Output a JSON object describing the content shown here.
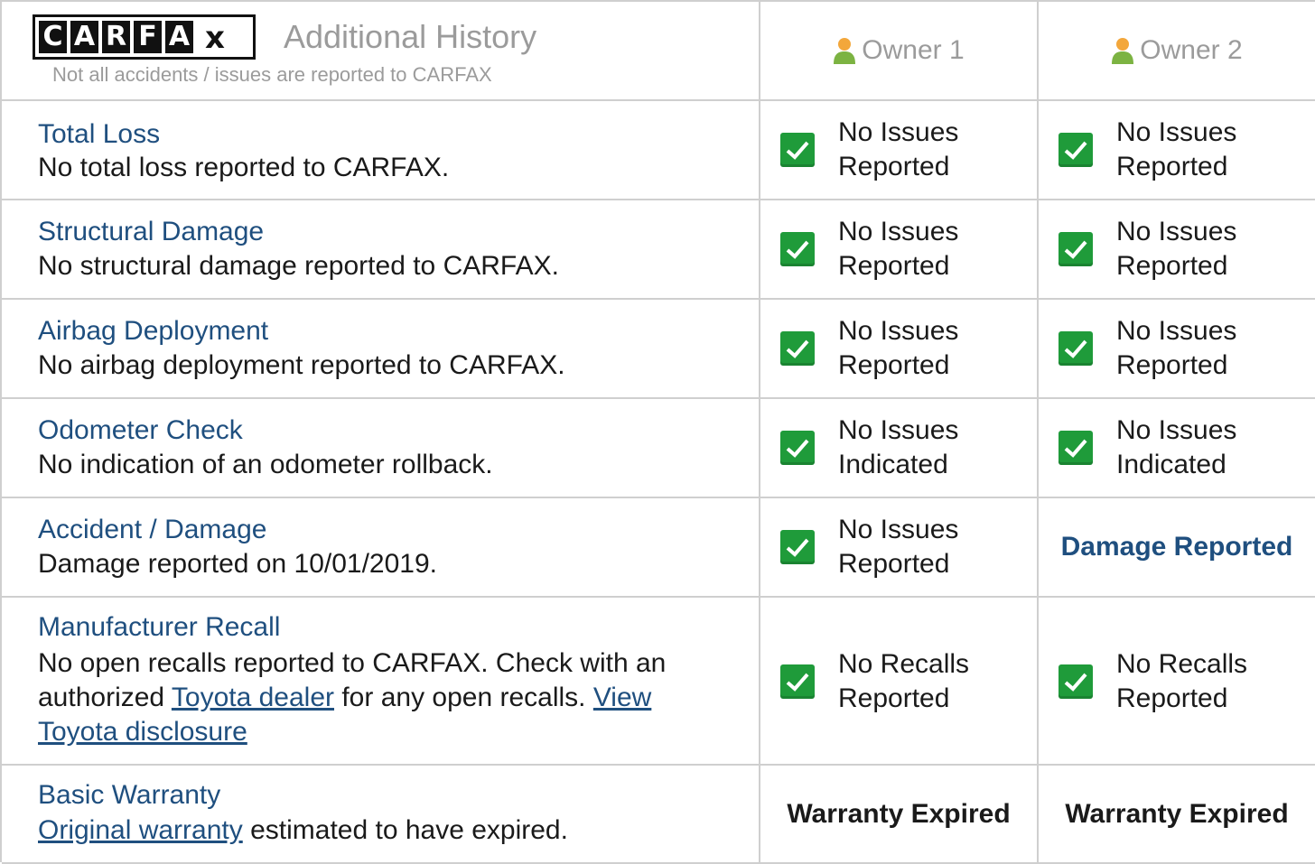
{
  "header": {
    "logo_letters": [
      "C",
      "A",
      "R",
      "F",
      "A"
    ],
    "logo_x": "x",
    "title": "Additional History",
    "subtitle": "Not all accidents / issues are reported to CARFAX",
    "owners": [
      "Owner 1",
      "Owner 2"
    ],
    "owner_icon": "person-icon"
  },
  "rows": {
    "total_loss": {
      "title": "Total Loss",
      "desc": "No total loss reported to CARFAX.",
      "owner1": [
        "No Issues",
        "Reported"
      ],
      "owner2": [
        "No Issues",
        "Reported"
      ]
    },
    "structural": {
      "title": "Structural Damage",
      "desc": "No structural damage reported to CARFAX.",
      "owner1": [
        "No Issues",
        "Reported"
      ],
      "owner2": [
        "No Issues",
        "Reported"
      ]
    },
    "airbag": {
      "title": "Airbag Deployment",
      "desc": "No airbag deployment reported to CARFAX.",
      "owner1": [
        "No Issues",
        "Reported"
      ],
      "owner2": [
        "No Issues",
        "Reported"
      ]
    },
    "odometer": {
      "title": "Odometer Check",
      "desc": "No indication of an odometer rollback.",
      "owner1": [
        "No Issues",
        "Indicated"
      ],
      "owner2": [
        "No Issues",
        "Indicated"
      ]
    },
    "accident": {
      "title": "Accident / Damage",
      "desc": "Damage reported on 10/01/2019.",
      "owner1": [
        "No Issues",
        "Reported"
      ],
      "owner2": "Damage Reported"
    },
    "recall": {
      "title": "Manufacturer Recall",
      "desc_part1": "No open recalls reported to CARFAX. Check with an authorized ",
      "dealer_link": "Toyota dealer",
      "desc_part2": " for any open recalls. ",
      "disclosure_link": "View Toyota disclosure",
      "owner1": [
        "No Recalls",
        "Reported"
      ],
      "owner2": [
        "No Recalls",
        "Reported"
      ]
    },
    "warranty": {
      "title": "Basic Warranty",
      "warranty_link": "Original warranty",
      "desc_rest": " estimated to have expired.",
      "owner1": "Warranty Expired",
      "owner2": "Warranty Expired"
    }
  },
  "colors": {
    "link_blue": "#1f4f7f",
    "check_green": "#1f9b3a",
    "muted_gray": "#9b9b9b",
    "border_gray": "#cfcfcf"
  }
}
